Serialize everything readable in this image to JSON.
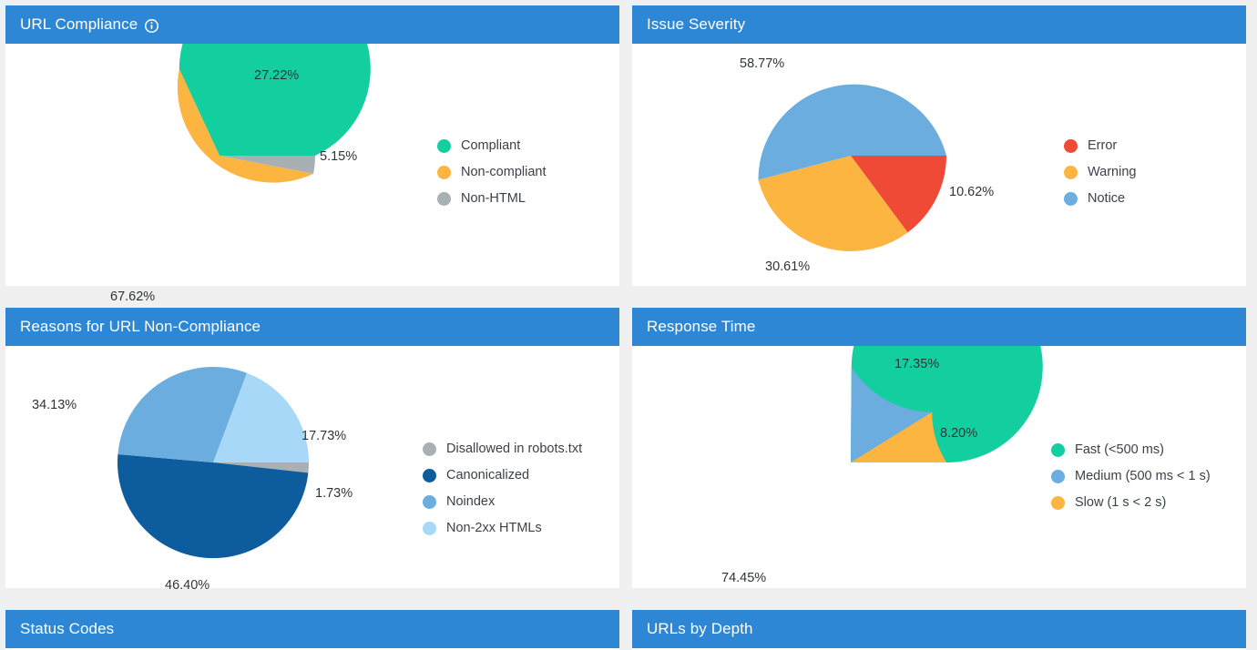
{
  "theme": {
    "header_blue": "#2d87d4",
    "page_background": "#f0f0f0",
    "panel_background": "#ffffff",
    "label_text": "#2f3437",
    "legend_text": "#3b4148"
  },
  "panels": [
    {
      "id": "url-compliance",
      "title": "URL Compliance",
      "has_info_icon": true,
      "info_icon_name": "info-icon"
    },
    {
      "id": "issue-severity",
      "title": "Issue Severity",
      "has_info_icon": false
    },
    {
      "id": "reasons-for-url-non-compliance",
      "title": "Reasons for URL Non-Compliance",
      "has_info_icon": false
    },
    {
      "id": "response-time",
      "title": "Response Time",
      "has_info_icon": false
    },
    {
      "id": "status-codes",
      "title": "Status Codes",
      "has_info_icon": false
    },
    {
      "id": "urls-by-depth",
      "title": "URLs by Depth",
      "has_info_icon": false
    }
  ],
  "chart_data": [
    {
      "type": "pie",
      "panel_id": "url-compliance",
      "title": "URL Compliance",
      "categories": [
        "Compliant",
        "Non-compliant",
        "Non-HTML"
      ],
      "values": [
        67.62,
        27.22,
        5.15
      ],
      "labels": [
        "67.62%",
        "27.22%",
        "5.15%"
      ],
      "colors": [
        "#13cfa0",
        "#fbb540",
        "#a9b0b3"
      ],
      "legend_position": "right",
      "start_angle_deg": 0,
      "direction": "counterclockwise"
    },
    {
      "type": "pie",
      "panel_id": "issue-severity",
      "title": "Issue Severity",
      "categories": [
        "Error",
        "Warning",
        "Notice"
      ],
      "values": [
        10.62,
        30.61,
        58.77
      ],
      "labels": [
        "10.62%",
        "30.61%",
        "58.77%"
      ],
      "colors": [
        "#ef4a36",
        "#fbb540",
        "#6caddf"
      ],
      "legend_position": "right",
      "start_angle_deg": 0,
      "direction": "clockwise"
    },
    {
      "type": "pie",
      "panel_id": "reasons-for-url-non-compliance",
      "title": "Reasons for URL Non-Compliance",
      "categories": [
        "Disallowed in robots.txt",
        "Canonicalized",
        "Noindex",
        "Non-2xx HTMLs"
      ],
      "values": [
        1.73,
        46.4,
        34.13,
        17.73
      ],
      "labels": [
        "1.73%",
        "46.40%",
        "34.13%",
        "17.73%"
      ],
      "colors": [
        "#a9b0b3",
        "#0d5c9e",
        "#6caddf",
        "#a7d8f7"
      ],
      "legend_position": "right",
      "start_angle_deg": 0,
      "direction": "clockwise"
    },
    {
      "type": "pie",
      "panel_id": "response-time",
      "title": "Response Time",
      "categories": [
        "Fast (<500 ms)",
        "Medium (500 ms < 1 s)",
        "Slow (1 s < 2 s)"
      ],
      "values": [
        74.45,
        17.35,
        8.2
      ],
      "labels": [
        "74.45%",
        "17.35%",
        "8.20%"
      ],
      "colors": [
        "#13cfa0",
        "#6caddf",
        "#fbb540"
      ],
      "legend_position": "right",
      "start_angle_deg": 0,
      "direction": "counterclockwise"
    }
  ]
}
